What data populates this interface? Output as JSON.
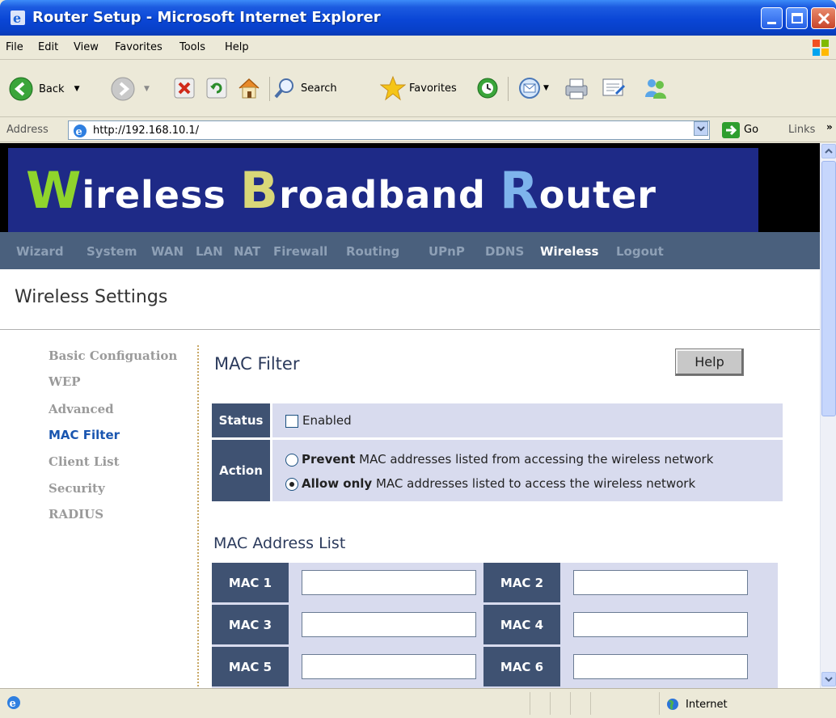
{
  "window": {
    "title": "Router Setup - Microsoft Internet Explorer"
  },
  "menu": [
    "File",
    "Edit",
    "View",
    "Favorites",
    "Tools",
    "Help"
  ],
  "toolbar": {
    "back": "Back",
    "search": "Search",
    "favorites": "Favorites"
  },
  "address": {
    "label": "Address",
    "url": "http://192.168.10.1/",
    "go": "Go",
    "links": "Links",
    "more": "»"
  },
  "banner": {
    "cap1": "W",
    "rest1": "ireless",
    "cap2": "B",
    "rest2": "roadband",
    "cap3": "R",
    "rest3": "outer"
  },
  "nav": [
    "Wizard",
    "System",
    "WAN",
    "LAN",
    "NAT",
    "Firewall",
    "Routing",
    "UPnP",
    "DDNS",
    "Wireless",
    "Logout"
  ],
  "nav_active": "Wireless",
  "page": {
    "section_title": "Wireless Settings"
  },
  "sidebar": [
    "Basic Configuation",
    "WEP",
    "Advanced",
    "MAC Filter",
    "Client List",
    "Security",
    "RADIUS"
  ],
  "sidebar_active": "MAC Filter",
  "content": {
    "title": "MAC Filter",
    "help": "Help",
    "status_label": "Status",
    "enabled_label": "Enabled",
    "enabled_checked": false,
    "action_label": "Action",
    "prevent_bold": "Prevent",
    "prevent_rest": " MAC addresses listed from accessing the wireless network",
    "allow_bold": "Allow only",
    "allow_rest": " MAC addresses listed to access the wireless network",
    "selected_action": "allow"
  },
  "mac_list": {
    "title": "MAC Address List",
    "labels": [
      "MAC 1",
      "MAC 2",
      "MAC 3",
      "MAC 4",
      "MAC 5",
      "MAC 6"
    ],
    "values": [
      "",
      "",
      "",
      "",
      "",
      ""
    ]
  },
  "status_bar": {
    "zone": "Internet"
  },
  "colors": {
    "nav_bg": "#4a607d",
    "banner_bg": "#1e2a87",
    "label_bg": "#3f5272",
    "row_bg": "#d8dbee",
    "active_link": "#1a56b0"
  }
}
